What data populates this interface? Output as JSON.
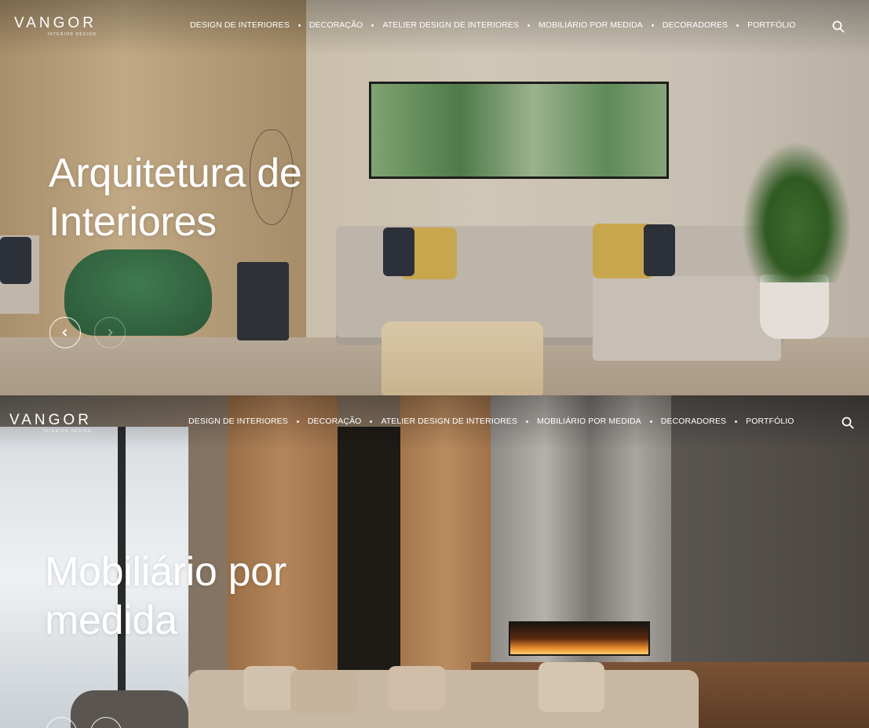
{
  "brand": {
    "name": "VANGOR",
    "tagline": "INTERIOR DESIGN"
  },
  "nav": {
    "items": [
      {
        "label": "DESIGN DE INTERIORES"
      },
      {
        "label": "DECORAÇÃO"
      },
      {
        "label": "ATELIER DESIGN DE INTERIORES"
      },
      {
        "label": "MOBILIÁRIO POR MEDIDA"
      },
      {
        "label": "DECORADORES"
      },
      {
        "label": "PORTFÓLIO"
      }
    ],
    "search_icon": "search-icon"
  },
  "slides": [
    {
      "title_line1": "Arquitetura de",
      "title_line2": "Interiores"
    },
    {
      "title_line1": "Mobiliário por",
      "title_line2": "medida"
    }
  ],
  "controls": {
    "prev_icon": "chevron-left-icon",
    "next_icon": "chevron-right-icon"
  },
  "colors": {
    "text": "#ffffff",
    "sofa": "#bdb4aa",
    "chair_green": "#2f5e3c",
    "painting_green": "#5f8a5a",
    "fire": "#e7892e"
  }
}
